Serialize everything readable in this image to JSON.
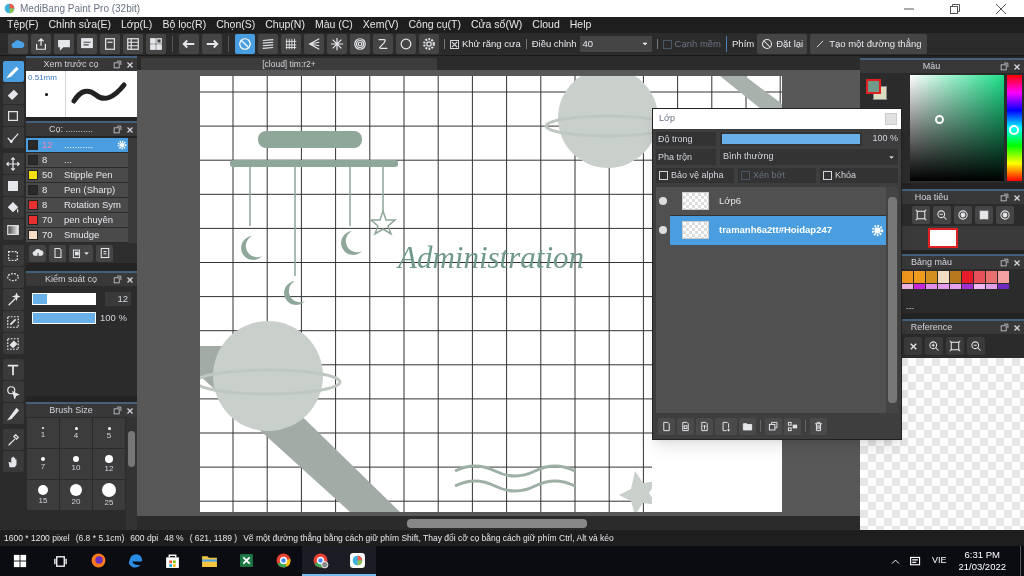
{
  "window": {
    "title": "MediBang Paint Pro (32bit)"
  },
  "menu": [
    "Tệp(F)",
    "Chỉnh sửa(E)",
    "Lớp(L)",
    "Bộ lọc(R)",
    "Chọn(S)",
    "Chụp(N)",
    "Màu (C)",
    "Xem(V)",
    "Công cụ(T)",
    "Cửa sổ(W)",
    "Cloud",
    "Help"
  ],
  "toolbar": {
    "snap_modes": [
      {
        "kind": "off",
        "selected": true
      },
      {
        "kind": "parallel",
        "selected": false
      },
      {
        "kind": "cross",
        "selected": false
      },
      {
        "kind": "perspective",
        "selected": false
      },
      {
        "kind": "radial",
        "selected": false
      },
      {
        "kind": "concentric",
        "selected": false
      },
      {
        "kind": "curve",
        "selected": false
      },
      {
        "kind": "ellipse",
        "selected": false
      }
    ],
    "antialias": {
      "label": "Khử răng cưa",
      "checked": true
    },
    "correction": {
      "label": "Điều chỉnh",
      "value": "40"
    },
    "soft_edge": {
      "label": "Cạnh mềm",
      "checked": false,
      "disabled": true
    },
    "key_label": "Phím",
    "reset_button": "Đặt lại",
    "line_button": "Tạo một đường thẳng"
  },
  "tools": [
    {
      "kind": "brush",
      "selected": true
    },
    {
      "kind": "eraser",
      "selected": false
    },
    {
      "kind": "square",
      "selected": false
    },
    {
      "kind": "polyline",
      "selected": false
    },
    {
      "kind": "move",
      "selected": false
    },
    {
      "kind": "fill_rect",
      "selected": false
    },
    {
      "kind": "bucket",
      "selected": false
    },
    {
      "kind": "gradient",
      "selected": false
    },
    {
      "kind": "select_rect",
      "selected": false
    },
    {
      "kind": "lasso",
      "selected": false
    },
    {
      "kind": "wand",
      "selected": false
    },
    {
      "kind": "select_pen",
      "selected": false
    },
    {
      "kind": "select_eraser",
      "selected": false
    },
    {
      "kind": "text",
      "selected": false
    },
    {
      "kind": "operation",
      "selected": false
    },
    {
      "kind": "blade",
      "selected": false
    },
    {
      "kind": "eyedropper",
      "selected": false
    },
    {
      "kind": "hand",
      "selected": false
    }
  ],
  "brush_preview": {
    "title": "Xem trước cọ",
    "size": "0.51mm"
  },
  "brush_panel": {
    "title": "Cọ: ...........",
    "brushes": [
      {
        "size": "12",
        "name": "...........",
        "color": "#2a2a2a",
        "selected": true
      },
      {
        "size": "8",
        "name": "...",
        "color": "#2a2a2a",
        "selected": false
      },
      {
        "size": "50",
        "name": "Stipple Pen",
        "color": "#f0e010",
        "selected": false
      },
      {
        "size": "8",
        "name": "Pen (Sharp)",
        "color": "#2a2a2a",
        "selected": false
      },
      {
        "size": "8",
        "name": "Rotation Sym",
        "color": "#e83030",
        "selected": false
      },
      {
        "size": "70",
        "name": "pen chuyên",
        "color": "#e83030",
        "selected": false
      },
      {
        "size": "70",
        "name": "Smudge",
        "color": "#f8dcc8",
        "selected": false
      }
    ]
  },
  "brush_control": {
    "title": "Kiểm soát cọ",
    "size": {
      "level": 0.22,
      "value": "12"
    },
    "opacity": {
      "level": 1,
      "value": "100 %"
    }
  },
  "brush_size": {
    "title": "Brush Size",
    "sizes": [
      "1",
      "4",
      "5",
      "7",
      "10",
      "12",
      "15",
      "20",
      "25"
    ]
  },
  "canvas": {
    "tab": "[cloud] tim:r2+",
    "art_text": "Administration"
  },
  "layer_window": {
    "title": "Lớp",
    "opacity": {
      "label": "Độ trong",
      "level": 1,
      "value": "100 %"
    },
    "blend": {
      "label": "Pha trộn",
      "value": "Bình thường"
    },
    "options": [
      {
        "label": "Bảo vệ alpha",
        "checked": false,
        "disabled": false
      },
      {
        "label": "Xén bớt",
        "checked": false,
        "disabled": true
      },
      {
        "label": "Khóa",
        "checked": false,
        "disabled": false
      }
    ],
    "layers": [
      {
        "name": "Lớp6",
        "selected": false
      },
      {
        "name": "tramanh6a2tt#Hoidap247",
        "selected": true
      }
    ]
  },
  "color_panel": {
    "title": "Màu",
    "hue": {
      "level": 0.48
    }
  },
  "navigator": {
    "title": "Hoa tiêu"
  },
  "palette": {
    "title": "Bảng màu",
    "swatches": [
      {
        "color": "#f0961e"
      },
      {
        "color": "#f09a1e"
      },
      {
        "color": "#d4901e"
      },
      {
        "color": "#f0dcc0"
      },
      {
        "color": "#b8781e"
      },
      {
        "color": "#e81c28"
      },
      {
        "color": "#e8505a"
      },
      {
        "color": "#e8706e"
      },
      {
        "color": "#f4a0a0"
      },
      {
        "color": "#f0b4e0"
      },
      {
        "color": "#c82ad8"
      },
      {
        "color": "#e090e8"
      },
      {
        "color": "#e49af0"
      },
      {
        "color": "#e8a0f0"
      },
      {
        "color": "#a030d0"
      },
      {
        "color": "#f0b8f0"
      },
      {
        "color": "#e0a0e8"
      },
      {
        "color": "#7028c0"
      }
    ],
    "entry": "---"
  },
  "reference": {
    "title": "Reference"
  },
  "status_bar": {
    "size": "1600 * 1200 pixel",
    "physical": "(6.8 * 5.1cm)",
    "dpi": "600 dpi",
    "zoom": "48 %",
    "cursor": "( 621, 1189 )",
    "hint": "Vẽ một đường thẳng bằng cách giữ phím Shift, Thay đổi cỡ cọ bằng cách giữ phím Ctrl, Alt và kéo"
  },
  "taskbar": {
    "apps": [
      {
        "kind": "firefox",
        "running": false
      },
      {
        "kind": "edge",
        "running": false
      },
      {
        "kind": "store",
        "running": false
      },
      {
        "kind": "explorer",
        "running": false
      },
      {
        "kind": "excel",
        "running": false
      },
      {
        "kind": "chrome",
        "running": false
      },
      {
        "kind": "chrome_user",
        "running": true
      },
      {
        "kind": "paint",
        "running": true
      }
    ],
    "language": "VIE",
    "time": "6:31 PM",
    "date": "21/03/2022"
  }
}
